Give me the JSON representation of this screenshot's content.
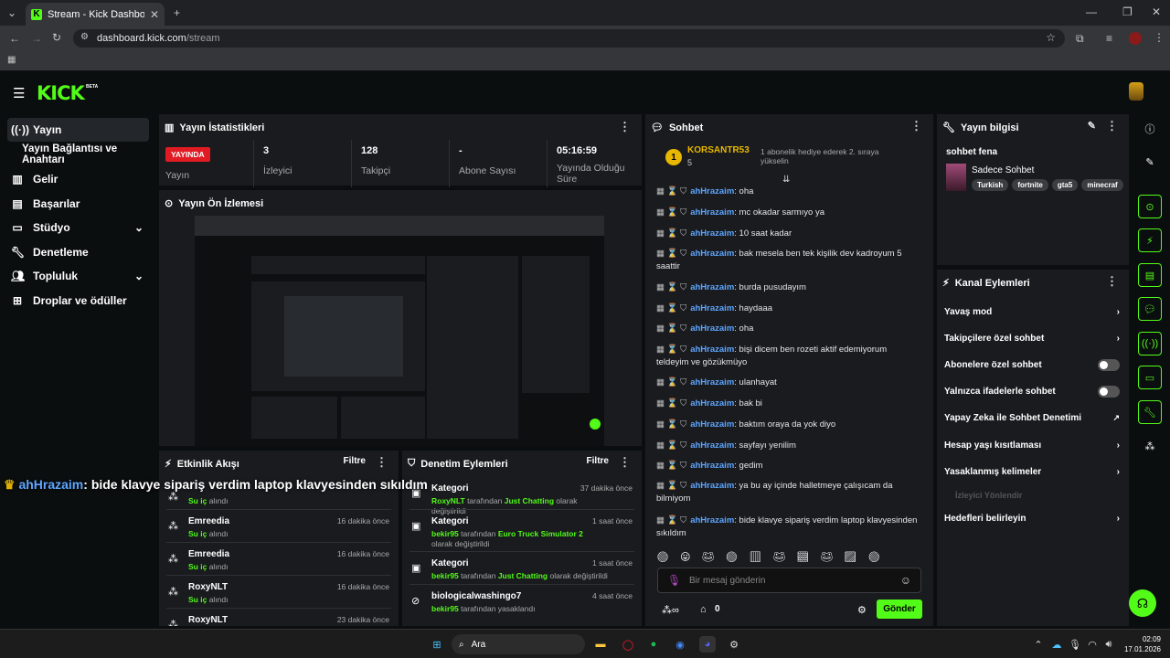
{
  "browser": {
    "tab_title": "Stream - Kick Dashboard",
    "url_host": "dashboard.kick.com",
    "url_path": "/stream"
  },
  "brand": {
    "logo": "KICK",
    "beta": "BETA",
    "accent": "#53fc18"
  },
  "sidebar": {
    "items": [
      {
        "label": "Yayın",
        "icon": "broadcast-icon"
      },
      {
        "label": "Yayın Bağlantısı ve Anahtarı",
        "icon": ""
      },
      {
        "label": "Gelir",
        "icon": "chart-icon"
      },
      {
        "label": "Başarılar",
        "icon": "trophy-icon"
      },
      {
        "label": "Stüdyo",
        "icon": "studio-icon"
      },
      {
        "label": "Denetleme",
        "icon": "wrench-icon"
      },
      {
        "label": "Topluluk",
        "icon": "people-icon"
      },
      {
        "label": "Droplar ve ödüller",
        "icon": "gift-icon"
      }
    ]
  },
  "stats": {
    "title": "Yayın İstatistikleri",
    "live_badge": "YAYINDA",
    "cols": [
      {
        "value": "",
        "label": "Yayın"
      },
      {
        "value": "3",
        "label": "İzleyici"
      },
      {
        "value": "128",
        "label": "Takipçi"
      },
      {
        "value": "-",
        "label": "Abone Sayısı"
      },
      {
        "value": "05:16:59",
        "label": "Yayında Olduğu Süre"
      }
    ]
  },
  "preview": {
    "title": "Yayın Ön İzlemesi"
  },
  "overlay": {
    "user": "ahHrazaim",
    "text": ": bide klavye sipariş verdim laptop klavyesinden sıkıldım"
  },
  "activity": {
    "title": "Etkinlik Akışı",
    "filter": "Filtre",
    "rows": [
      {
        "name": "Emreedia",
        "sub": "Su iç",
        "sub2": "alındı",
        "time": "16 dakika önce"
      },
      {
        "name": "Emreedia",
        "sub": "Su iç",
        "sub2": "alındı",
        "time": "16 dakika önce"
      },
      {
        "name": "RoxyNLT",
        "sub": "Su iç",
        "sub2": "alındı",
        "time": "16 dakika önce"
      },
      {
        "name": "RoxyNLT",
        "sub": "",
        "sub2": "",
        "time": "23 dakika önce"
      }
    ],
    "partial_time": "",
    "partial_sub": "Su iç",
    "partial_sub2": "alındı"
  },
  "moderation": {
    "title": "Denetim Eylemleri",
    "filter": "Filtre",
    "rows": [
      {
        "title": "Kategori",
        "user": "RoxyNLT",
        "mid": "tarafından",
        "target": "Just Chatting",
        "end": "olarak değiştirildi",
        "time": "37 dakika önce"
      },
      {
        "title": "Kategori",
        "user": "bekir95",
        "mid": "tarafından",
        "target": "Euro Truck Simulator 2",
        "end": "olarak değiştirildi",
        "time": "1 saat önce"
      },
      {
        "title": "Kategori",
        "user": "bekir95",
        "mid": "tarafından",
        "target": "Just Chatting",
        "end": "olarak değiştirildi",
        "time": "1 saat önce"
      },
      {
        "title": "biologicalwashingo7",
        "user": "bekir95",
        "mid": "tarafından yasaklandı",
        "target": "",
        "end": "",
        "time": "4 saat önce"
      }
    ]
  },
  "chat": {
    "title": "Sohbet",
    "top_user": "KORSANTR53",
    "top_count": "5",
    "top_note": "1 abonelik hediye ederek 2. sıraya yükselin",
    "input_placeholder": "Bir mesaj gönderin",
    "points": "0",
    "send": "Gönder",
    "messages": [
      {
        "user": "ahHrazaim",
        "text": ": oha"
      },
      {
        "user": "ahHrazaim",
        "text": ": mc okadar sarmıyo ya"
      },
      {
        "user": "ahHrazaim",
        "text": ": 10 saat kadar"
      },
      {
        "user": "ahHrazaim",
        "text": ": bak mesela ben tek kişilik dev kadroyum 5 saattir"
      },
      {
        "user": "ahHrazaim",
        "text": ": burda pusudayım"
      },
      {
        "user": "ahHrazaim",
        "text": ": haydaaa"
      },
      {
        "user": "ahHrazaim",
        "text": ": oha"
      },
      {
        "user": "ahHrazaim",
        "text": ": bişi dicem ben rozeti aktif edemiyorum teldeyim ve gözükmüyo"
      },
      {
        "user": "ahHrazaim",
        "text": ": ulanhayat"
      },
      {
        "user": "ahHrazaim",
        "text": ": bak bi"
      },
      {
        "user": "ahHrazaim",
        "text": ": baktım oraya da yok diyo"
      },
      {
        "user": "ahHrazaim",
        "text": ": sayfayı yenilim"
      },
      {
        "user": "ahHrazaim",
        "text": ": gedim"
      },
      {
        "user": "ahHrazaim",
        "text": ": ya bu ay içinde halletmeye çalışıcam da bilmiyom"
      },
      {
        "user": "ahHrazaim",
        "text": ": bide klavye sipariş verdim laptop klavyesinden sıkıldım"
      }
    ]
  },
  "info": {
    "title": "Yayın bilgisi",
    "stream_title": "sohbet fena",
    "category": "Sadece Sohbet",
    "tags": [
      "Turkish",
      "fortnite",
      "gta5",
      "minecraf"
    ]
  },
  "actions": {
    "title": "Kanal Eylemleri",
    "items": [
      {
        "label": "Yavaş mod",
        "kind": "arrow"
      },
      {
        "label": "Takipçilere özel sohbet",
        "kind": "arrow"
      },
      {
        "label": "Abonelere özel sohbet",
        "kind": "toggle"
      },
      {
        "label": "Yalnızca ifadelerle sohbet",
        "kind": "toggle"
      },
      {
        "label": "Yapay Zeka ile Sohbet Denetimi",
        "kind": "ext"
      },
      {
        "label": "Hesap yaşı kısıtlaması",
        "kind": "arrow"
      },
      {
        "label": "Yasaklanmış kelimeler",
        "kind": "arrow"
      }
    ],
    "section": "İzleyici Yönlendir",
    "goals": "Hedefleri belirleyin"
  },
  "taskbar": {
    "search": "Ara",
    "time": "02:09",
    "date": "17.01.2026"
  }
}
